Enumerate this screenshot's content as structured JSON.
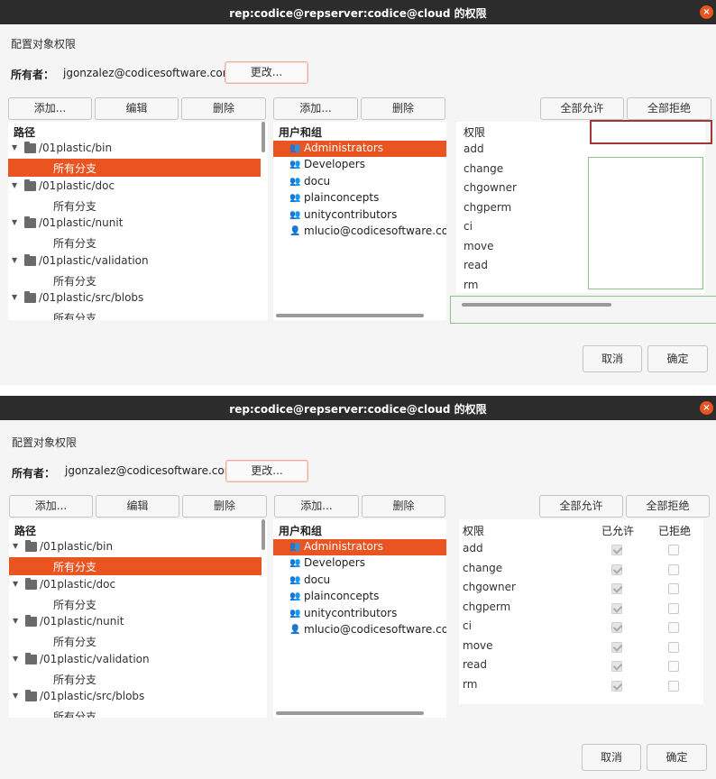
{
  "window": {
    "title": "rep:codice@repserver:codice@cloud 的权限",
    "close_icon": "×"
  },
  "section_heading": "配置对象权限",
  "owner": {
    "label": "所有者：",
    "value": "jgonzalez@codicesoftware.com",
    "change_button": "更改..."
  },
  "paths": {
    "buttons": {
      "add": "添加...",
      "edit": "编辑",
      "delete": "删除"
    },
    "header": "路径",
    "items": [
      {
        "path": "/01plastic/bin",
        "branch": "所有分支"
      },
      {
        "path": "/01plastic/doc",
        "branch": "所有分支"
      },
      {
        "path": "/01plastic/nunit",
        "branch": "所有分支"
      },
      {
        "path": "/01plastic/validation",
        "branch": "所有分支"
      },
      {
        "path": "/01plastic/src/blobs",
        "branch": "所有分支"
      }
    ]
  },
  "users": {
    "buttons": {
      "add": "添加...",
      "delete": "删除"
    },
    "header": "用户和组",
    "items": [
      {
        "name": "Administrators",
        "icon": "group-icon"
      },
      {
        "name": "Developers",
        "icon": "group-icon"
      },
      {
        "name": "docu",
        "icon": "group-icon"
      },
      {
        "name": "plainconcepts",
        "icon": "group-icon"
      },
      {
        "name": "unitycontributors",
        "icon": "group-icon"
      },
      {
        "name": "mlucio@codicesoftware.com",
        "icon": "user-icon"
      }
    ]
  },
  "permissions": {
    "buttons": {
      "allow_all": "全部允许",
      "deny_all": "全部拒绝"
    },
    "header": "权限",
    "allowed_header": "已允许",
    "denied_header": "已拒绝",
    "items": [
      {
        "name": "add",
        "allowed": true,
        "denied": false
      },
      {
        "name": "change",
        "allowed": true,
        "denied": false
      },
      {
        "name": "chgowner",
        "allowed": true,
        "denied": false
      },
      {
        "name": "chgperm",
        "allowed": true,
        "denied": false
      },
      {
        "name": "ci",
        "allowed": true,
        "denied": false
      },
      {
        "name": "move",
        "allowed": true,
        "denied": false
      },
      {
        "name": "read",
        "allowed": true,
        "denied": false
      },
      {
        "name": "rm",
        "allowed": true,
        "denied": false
      }
    ]
  },
  "footer": {
    "cancel": "取消",
    "ok": "确定"
  },
  "colors": {
    "accent": "#e95420",
    "titlebar": "#2c2c2c",
    "dialog_bg": "#f5f5f5"
  }
}
